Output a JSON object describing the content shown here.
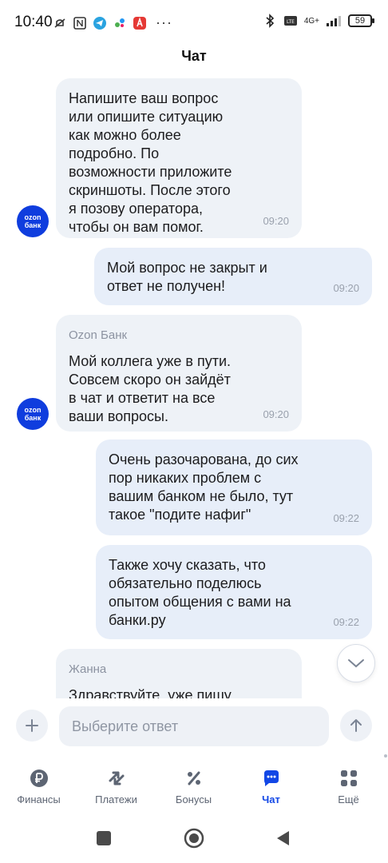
{
  "status_bar": {
    "time": "10:40",
    "battery": "59",
    "network": "4G+"
  },
  "header": {
    "title": "Чат"
  },
  "avatar": {
    "text_line1": "ozon",
    "text_line2": "банк",
    "color": "#0f3dde"
  },
  "messages": [
    {
      "direction": "in",
      "sender": "",
      "text": "Напишите ваш вопрос\nили опишите ситуацию\nкак можно более\nподробно. По\nвозможности приложите\nскриншоты. После этого\nя позову оператора,\nчтобы он вам помог.",
      "time": "09:20"
    },
    {
      "direction": "out",
      "text": "Мой вопрос не закрыт и\nответ не получен!",
      "time": "09:20"
    },
    {
      "direction": "in",
      "sender": "Ozon Банк",
      "text": "Мой коллега уже в пути.\nСовсем скоро он зайдёт\nв чат и ответит на все\nваши вопросы.",
      "time": "09:20"
    },
    {
      "direction": "out",
      "text": "Очень разочарована, до сих\nпор никаких проблем с\nвашим банком не было, тут\nтакое \"подите нафиг\"",
      "time": "09:22"
    },
    {
      "direction": "out",
      "text": "Также хочу сказать, что\nобязательно поделюсь\nопытом общения с вами на\nбанки.ру",
      "time": "09:22"
    },
    {
      "direction": "in",
      "sender": "Жанна",
      "text": "Здравствуйте, уже пишу",
      "time": ""
    }
  ],
  "composer": {
    "placeholder": "Выберите ответ"
  },
  "bottom_nav": {
    "items": [
      {
        "label": "Финансы",
        "icon": "ruble-icon",
        "active": false
      },
      {
        "label": "Платежи",
        "icon": "transfer-arrows-icon",
        "active": false
      },
      {
        "label": "Бонусы",
        "icon": "percent-icon",
        "active": false
      },
      {
        "label": "Чат",
        "icon": "chat-icon",
        "active": true
      },
      {
        "label": "Ещё",
        "icon": "grid-icon",
        "active": false
      }
    ],
    "active_color": "#1247e6"
  }
}
